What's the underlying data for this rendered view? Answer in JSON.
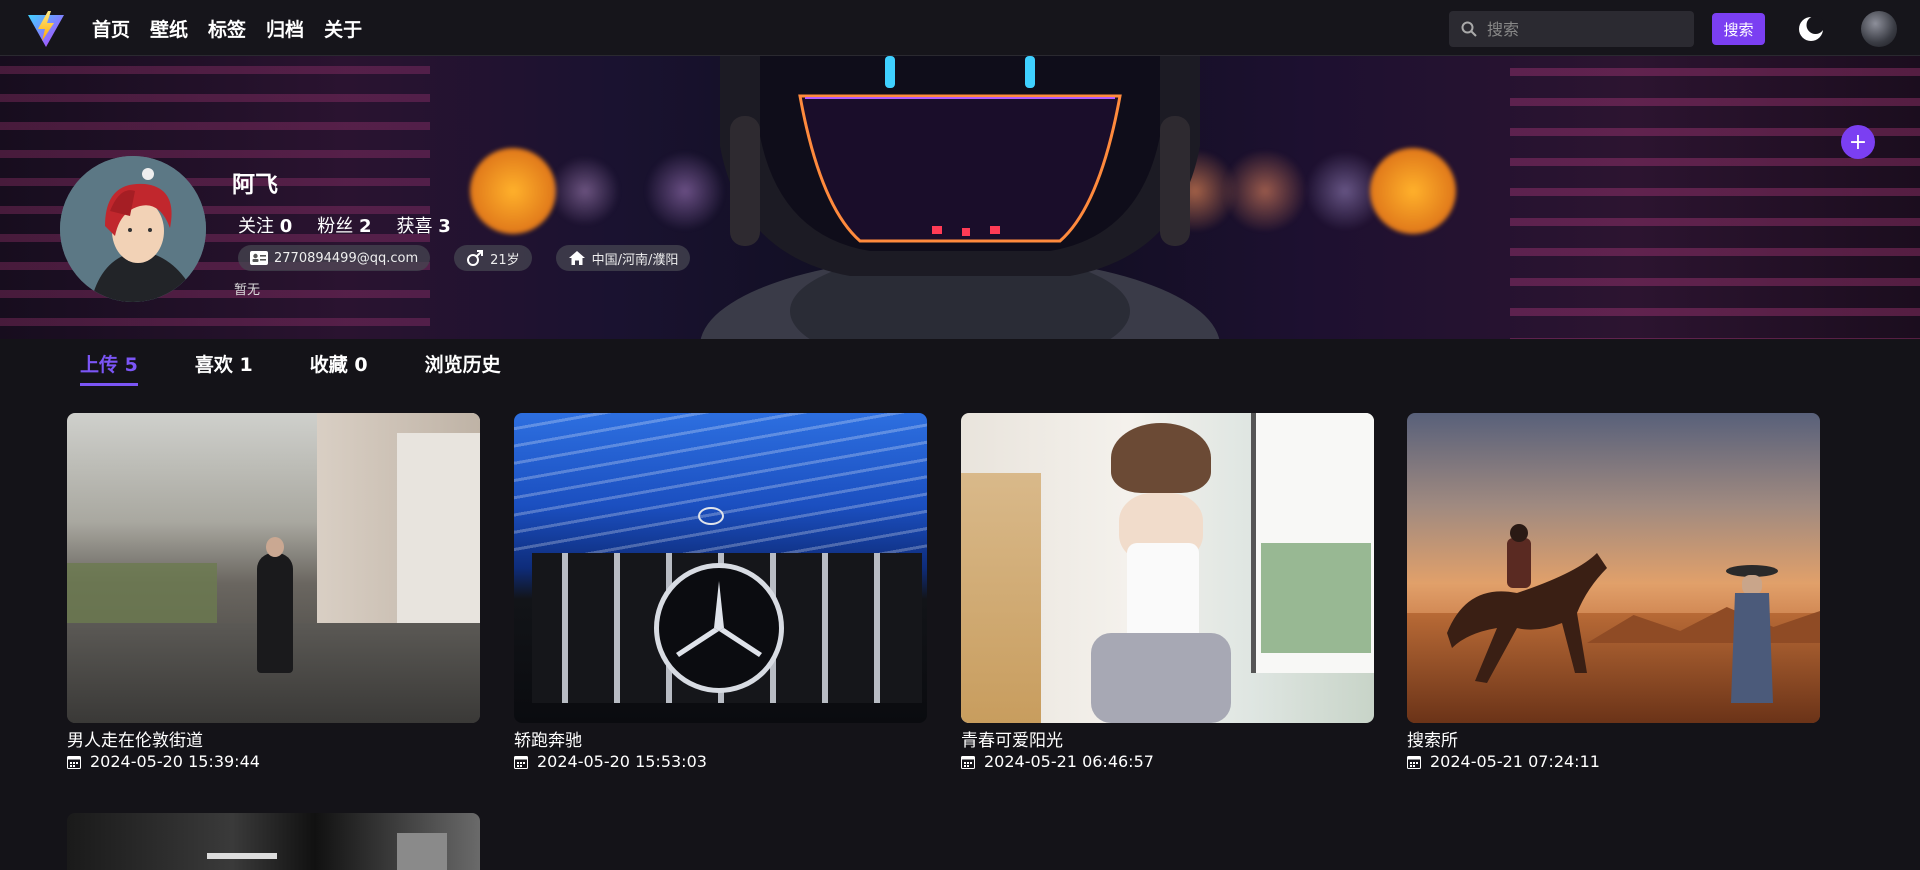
{
  "nav": {
    "links": [
      "首页",
      "壁纸",
      "标签",
      "归档",
      "关于"
    ],
    "search_placeholder": "搜索",
    "search_button": "搜索"
  },
  "profile": {
    "name": "阿飞",
    "follow_label": "关注",
    "follow_count": "0",
    "fans_label": "粉丝",
    "fans_count": "2",
    "likes_label": "获喜",
    "likes_count": "3",
    "email": "2770894499@qq.com",
    "age": "21岁",
    "location": "中国/河南/濮阳",
    "bio": "暂无"
  },
  "tabs": [
    {
      "label": "上传",
      "count": "5"
    },
    {
      "label": "喜欢",
      "count": "1"
    },
    {
      "label": "收藏",
      "count": "0"
    },
    {
      "label": "浏览历史",
      "count": ""
    }
  ],
  "cards": [
    {
      "title": "男人走在伦敦街道",
      "date": "2024-05-20 15:39:44"
    },
    {
      "title": "轿跑奔驰",
      "date": "2024-05-20 15:53:03"
    },
    {
      "title": "青春可爱阳光",
      "date": "2024-05-21 06:46:57"
    },
    {
      "title": "搜索所",
      "date": "2024-05-21 07:24:11"
    }
  ],
  "colors": {
    "accent": "#7b3ff2",
    "background": "#141318"
  }
}
